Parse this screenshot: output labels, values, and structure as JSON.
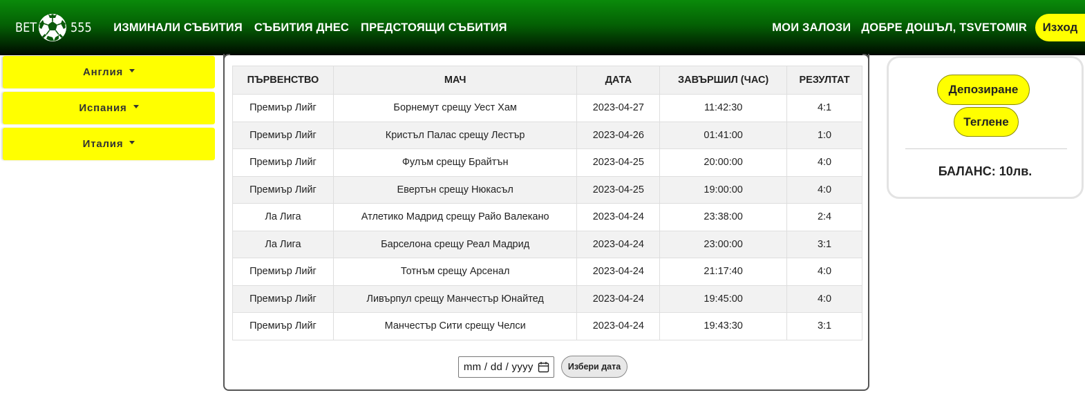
{
  "brand": {
    "left": "BET",
    "right": "555",
    "ball_icon": "soccer-ball-icon"
  },
  "nav": {
    "links": [
      "ИЗМИНАЛИ СЪБИТИЯ",
      "СЪБИТИЯ ДНЕС",
      "ПРЕДСТОЯЩИ СЪБИТИЯ"
    ],
    "my_bets": "МОИ ЗАЛОЗИ",
    "welcome": "ДОБРЕ ДОШЪЛ, TSVETOMIR",
    "logout": "Изход"
  },
  "sidebar": {
    "leagues": [
      "Англия",
      "Испания",
      "Италия"
    ]
  },
  "table": {
    "headers": [
      "ПЪРВЕНСТВО",
      "МАЧ",
      "ДАТА",
      "ЗАВЪРШИЛ (ЧАС)",
      "РЕЗУЛТАТ"
    ],
    "rows": [
      [
        "Премиър Лийг",
        "Борнемут срещу Уест Хам",
        "2023-04-27",
        "11:42:30",
        "4:1"
      ],
      [
        "Премиър Лийг",
        "Кристъл Палас срещу Лестър",
        "2023-04-26",
        "01:41:00",
        "1:0"
      ],
      [
        "Премиър Лийг",
        "Фулъм срещу Брайтън",
        "2023-04-25",
        "20:00:00",
        "4:0"
      ],
      [
        "Премиър Лийг",
        "Евертън срещу Нюкасъл",
        "2023-04-25",
        "19:00:00",
        "4:0"
      ],
      [
        "Ла Лига",
        "Атлетико Мадрид срещу Райо Валекано",
        "2023-04-24",
        "23:38:00",
        "2:4"
      ],
      [
        "Ла Лига",
        "Барселона срещу Реал Мадрид",
        "2023-04-24",
        "23:00:00",
        "3:1"
      ],
      [
        "Премиър Лийг",
        "Тотнъм срещу Арсенал",
        "2023-04-24",
        "21:17:40",
        "4:0"
      ],
      [
        "Премиър Лийг",
        "Ливърпул срещу Манчестър Юнайтед",
        "2023-04-24",
        "19:45:00",
        "4:0"
      ],
      [
        "Премиър Лийг",
        "Манчестър Сити срещу Челси",
        "2023-04-24",
        "19:43:30",
        "3:1"
      ]
    ]
  },
  "date_picker": {
    "placeholder": "mm / dd / yyyy",
    "icon": "calendar-icon",
    "button": "Избери дата"
  },
  "account": {
    "deposit": "Депозиране",
    "withdraw": "Теглене",
    "balance": "БАЛАНС: 10лв."
  },
  "colors": {
    "accent_yellow": "#ffff00",
    "nav_green": "#046004"
  }
}
